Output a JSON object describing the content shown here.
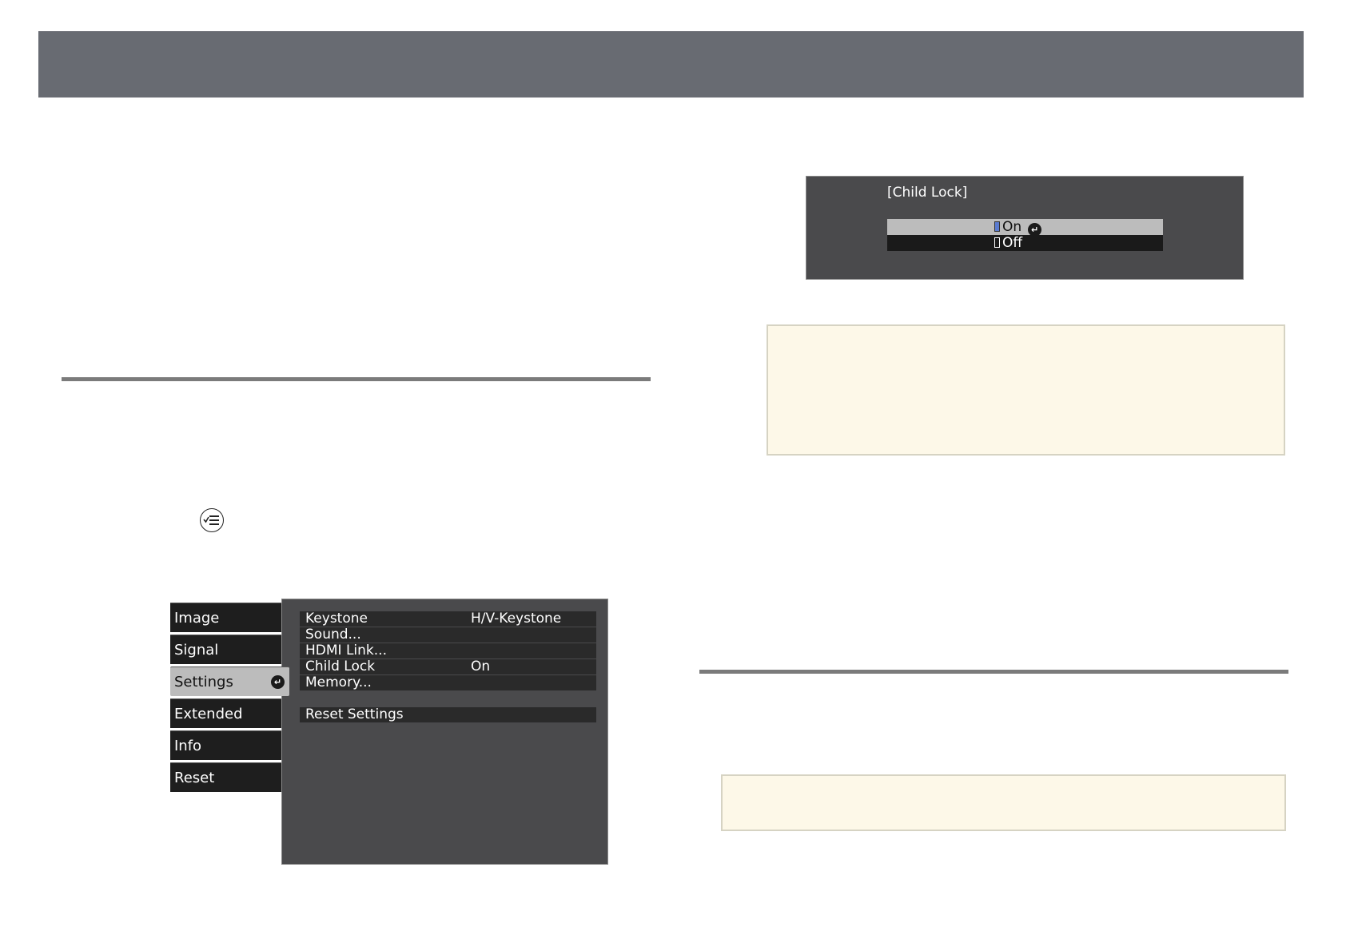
{
  "menu": {
    "tabs": [
      {
        "label": "Image",
        "selected": false
      },
      {
        "label": "Signal",
        "selected": false
      },
      {
        "label": "Settings",
        "selected": true
      },
      {
        "label": "Extended",
        "selected": false
      },
      {
        "label": "Info",
        "selected": false
      },
      {
        "label": "Reset",
        "selected": false
      }
    ],
    "settings_items": [
      {
        "label": "Keystone",
        "value": "H/V-Keystone"
      },
      {
        "label": "Sound...",
        "value": ""
      },
      {
        "label": "HDMI Link...",
        "value": ""
      },
      {
        "label": "Child Lock",
        "value": "On"
      },
      {
        "label": "Memory...",
        "value": ""
      }
    ],
    "reset_item": "Reset Settings"
  },
  "child_lock_dialog": {
    "title": "[Child Lock]",
    "options": [
      {
        "label": "On",
        "selected": true
      },
      {
        "label": "Off",
        "selected": false
      }
    ]
  },
  "colors": {
    "header_bar": "#686b72",
    "osd_background": "#4a4a4c",
    "selected_item": "#bcbcbc",
    "note_background": "#fdf8e8"
  }
}
